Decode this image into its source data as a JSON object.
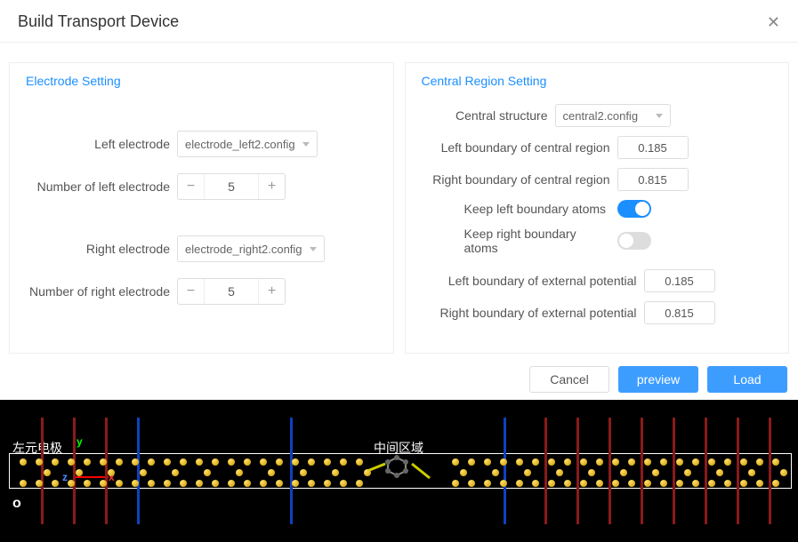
{
  "header": {
    "title": "Build Transport Device"
  },
  "electrode": {
    "panel_title": "Electrode Setting",
    "left_electrode_label": "Left electrode",
    "left_electrode_value": "electrode_left2.config",
    "num_left_label": "Number of left electrode",
    "num_left_value": "5",
    "right_electrode_label": "Right electrode",
    "right_electrode_value": "electrode_right2.config",
    "num_right_label": "Number of right electrode",
    "num_right_value": "5"
  },
  "central": {
    "panel_title": "Central Region Setting",
    "structure_label": "Central structure",
    "structure_value": "central2.config",
    "left_boundary_label": "Left boundary of central region",
    "left_boundary_value": "0.185",
    "right_boundary_label": "Right boundary of central region",
    "right_boundary_value": "0.815",
    "keep_left_label": "Keep left boundary atoms",
    "keep_right_label": "Keep right boundary atoms",
    "left_ext_label": "Left boundary of external potential",
    "left_ext_value": "0.185",
    "right_ext_label": "Right boundary of external potential",
    "right_ext_value": "0.815"
  },
  "buttons": {
    "cancel": "Cancel",
    "preview": "preview",
    "load": "Load"
  },
  "viz": {
    "left_label": "左元电极",
    "center_label": "中间区域",
    "axis_x": "x",
    "axis_y": "y",
    "axis_z": "z",
    "origin": "o"
  }
}
